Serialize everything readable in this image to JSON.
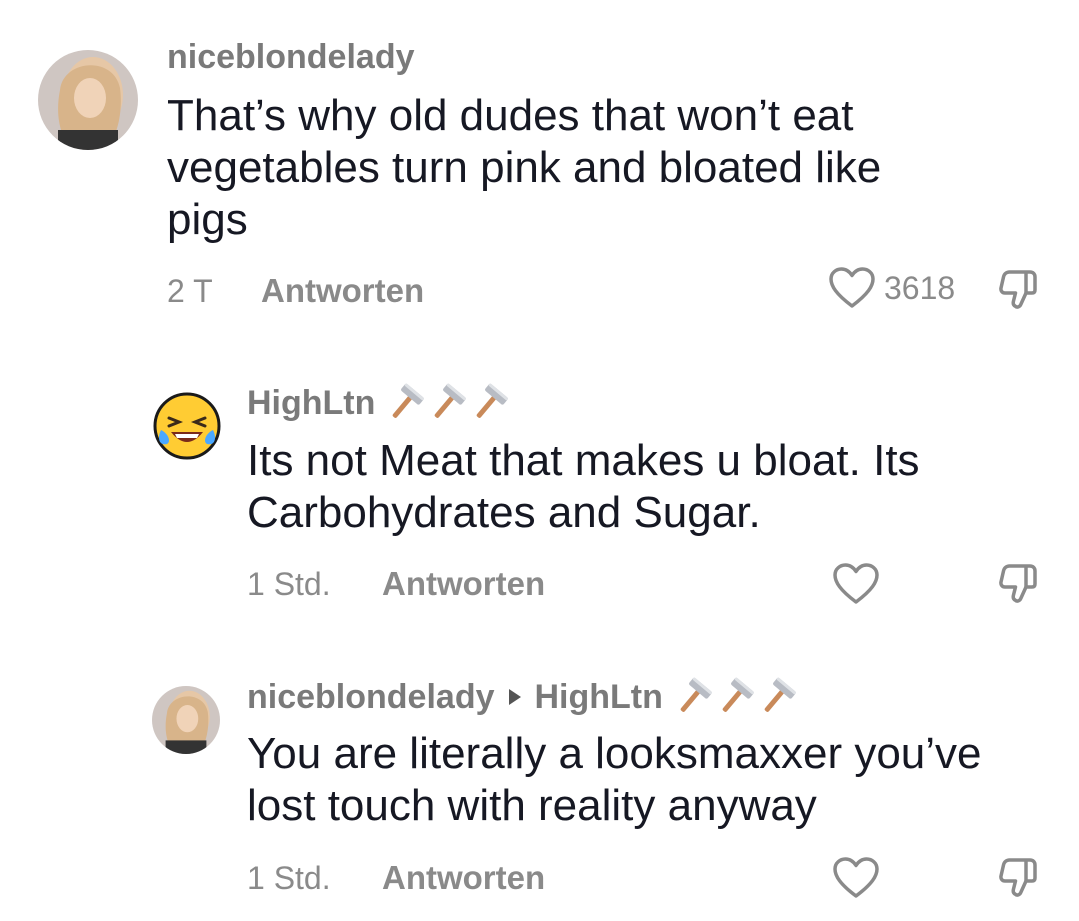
{
  "comments": [
    {
      "username": "niceblondelady",
      "text": "That’s why old dudes that won’t eat vegetables turn pink and bloated like pigs",
      "time": "2 T",
      "reply_label": "Antworten",
      "likes": "3618",
      "avatar_icon": "profile-photo"
    },
    {
      "username": "HighLtn",
      "username_emoji": "hammer-icon",
      "text": "Its not Meat that makes u bloat. Its Carbohydrates and Sugar.",
      "time": "1 Std.",
      "reply_label": "Antworten",
      "likes": "",
      "avatar_icon": "laughing-crying-emoji"
    },
    {
      "username": "niceblondelady",
      "reply_to": "HighLtn",
      "username_emoji": "hammer-icon",
      "text": "You are literally a looksmaxxer you’ve lost touch with reality anyway",
      "time": "1 Std.",
      "reply_label": "Antworten",
      "likes": "",
      "avatar_icon": "profile-photo"
    }
  ],
  "colors": {
    "text": "#161823",
    "muted": "#8a8a8a",
    "username": "#7a7a7a"
  }
}
